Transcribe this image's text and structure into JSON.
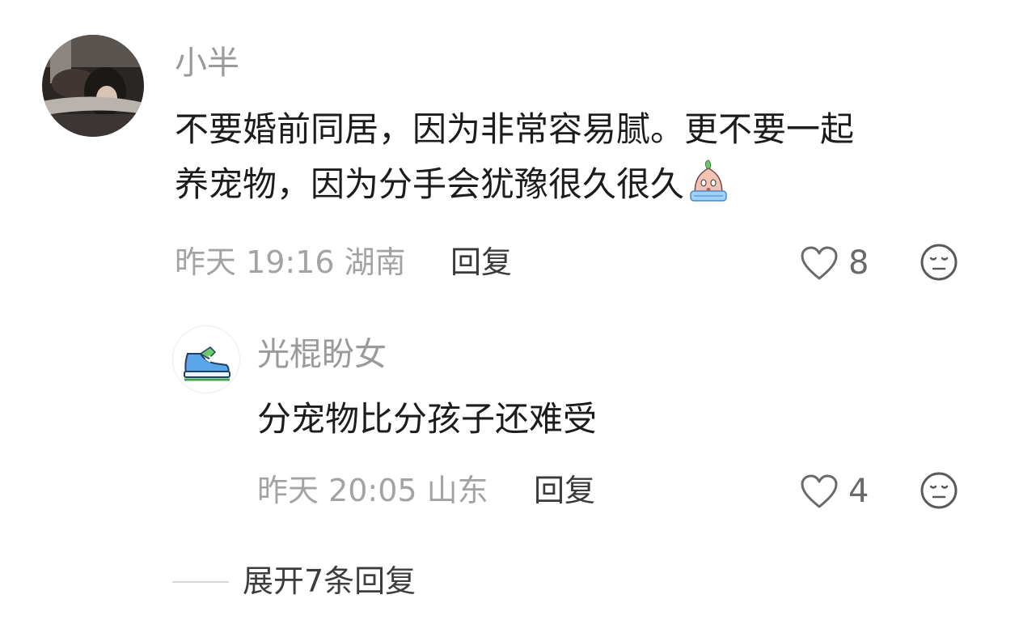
{
  "comment": {
    "username": "小半",
    "text_line1": "不要婚前同居，因为非常容易腻。更不要一起",
    "text_line2": "养宠物，因为分手会犹豫很久很久",
    "time_location": "昨天 19:16 湖南",
    "reply_label": "回复",
    "like_count": "8",
    "emoji_icon": "crying-face-emoji"
  },
  "reply": {
    "username": "光棍盼女",
    "text": "分宠物比分孩子还难受",
    "time_location": "昨天 20:05 山东",
    "reply_label": "回复",
    "like_count": "4",
    "avatar_icon": "sneaker-icon"
  },
  "expand": {
    "label": "展开7条回复"
  }
}
